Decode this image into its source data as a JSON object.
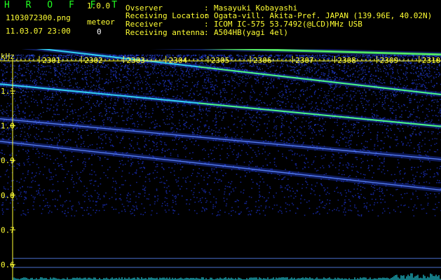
{
  "header": {
    "app_name": "H R O F F T",
    "version": "1.0.0",
    "filename": "1103072300.png",
    "datetime": "11.03.07 23:00",
    "meteor_label": "meteor",
    "meteor_count": "0"
  },
  "info": [
    {
      "key": "Ovserver",
      "value": "Masayuki Kobayashi"
    },
    {
      "key": "Receiving Location",
      "value": "Ogata-vill. Akita-Pref. JAPAN (139.96E, 40.02N)"
    },
    {
      "key": "Receiver",
      "value": "ICOM IC-575 53.7492(@LCD)MHz USB"
    },
    {
      "key": "Receiving antenna",
      "value": "A504HB(yagi 4el)"
    }
  ],
  "spectrogram": {
    "unit": "kHz",
    "time_labels": [
      "2301",
      "2302",
      "2303",
      "2304",
      "2305",
      "2306",
      "2307",
      "2308",
      "2309",
      "2310"
    ],
    "freq_labels": [
      "1.1",
      "1.0",
      "0.9",
      "0.8",
      "0.7",
      "0.6"
    ],
    "freq_values": [
      1.1,
      1.0,
      0.9,
      0.8,
      0.7,
      0.6
    ],
    "ref_lines_khz": [
      0.618,
      0.592
    ],
    "traces": [
      {
        "start_khz": 1.235,
        "end_khz": 1.09
      },
      {
        "start_khz": 1.12,
        "end_khz": 0.998
      },
      {
        "start_khz": 1.02,
        "end_khz": 0.903
      },
      {
        "start_khz": 0.955,
        "end_khz": 0.815
      },
      {
        "start_khz": 1.24,
        "end_khz": 1.205
      }
    ],
    "colors": {
      "text": "#ffff33",
      "label_green": "#22ff22",
      "noise_blue": "#1b2fbf",
      "trace_cyan": "#33ddff",
      "trace_green": "#55ff55",
      "ref_line": "#4a6fd0"
    }
  }
}
